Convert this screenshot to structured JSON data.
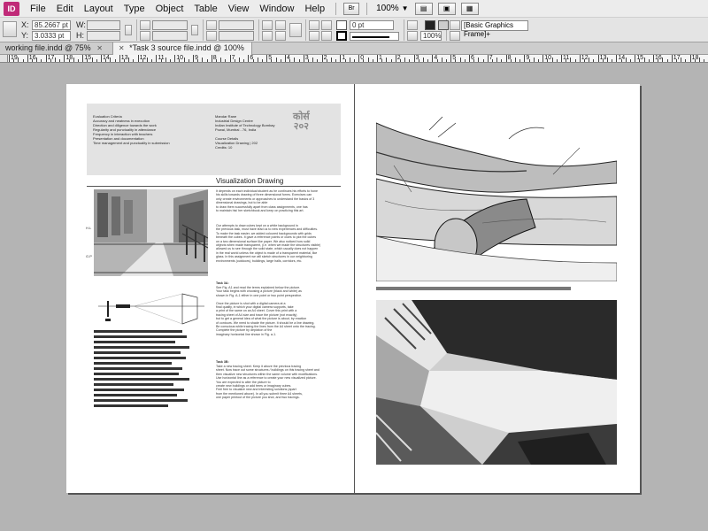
{
  "app": {
    "logo": "ID"
  },
  "menu": {
    "items": [
      "File",
      "Edit",
      "Layout",
      "Type",
      "Object",
      "Table",
      "View",
      "Window",
      "Help"
    ]
  },
  "toolbar": {
    "bridge": "Br",
    "zoom": "100%"
  },
  "control": {
    "x_label": "X:",
    "y_label": "Y:",
    "w_label": "W:",
    "h_label": "H:",
    "x_value": "85.2667 pt",
    "y_value": "3.0333 pt",
    "stroke_weight": "0 pt",
    "opacity": "100%",
    "object_style": "[Basic Graphics Frame]+"
  },
  "tabs": [
    {
      "label": "working file.indd @ 75%",
      "active": false
    },
    {
      "label": "*Task 3 source file.indd @ 100%",
      "active": true
    }
  ],
  "ruler": {
    "numbers": [
      "19",
      "16",
      "17",
      "18",
      "15",
      "14",
      "13",
      "12",
      "11",
      "10",
      "9",
      "8",
      "7",
      "6",
      "5",
      "4",
      "3",
      "2",
      "1",
      "0",
      "1",
      "2",
      "3",
      "4",
      "5",
      "6",
      "7",
      "8",
      "9",
      "10",
      "11",
      "12",
      "13",
      "14",
      "15",
      "16",
      "17",
      "18",
      "19"
    ]
  },
  "left_page": {
    "col1": "Evaluation Criteria\nAccuracy and neatness in execution\nDirection and diligence towards the work\nRegularity and punctuality in attendance\nFrequency in interaction with teachers\nPresentation and documentation\nTime management and punctuality in submission",
    "col2": "Mandar Rane\nIndustrial Design Centre\nIndian Institute of Technology Bombay\nPowai, Mumbai - 76, India\n\nCourse Details\nVisualization Drawing | 202\nCredits: 10",
    "hindi_mark": "कोर्स\n२०२",
    "title": "Visualization Drawing",
    "hl_label": "H.L",
    "gp_label": "G.P",
    "body_1": "It depends on each individual student as he continues his efforts to hone\nhis skills towards drawing of three dimensional forms. Exercises can\nonly create environments or approaches to understand the basics of 3\ndimensional drawings, but to be able\nto draw them successfully apart from class assignments, one has\nto maintain his/ her sketchbook and keep on practicing this art.",
    "body_2": "Our attempts to draw cubes kept on a white background in\nthe previous task, must have lead us to new experiences and difficulties.\nTo make the task easier, we added coloured backgrounds with grids\nbeneath the cubes. It gave a reference points or clues to plot the cubes\non a two dimensional surface like paper. We also noticed how solid\nobjects when made transparent, (i.e. when we made the structures visible)\nallowed us to see through the solid state, which usually does not happen\nin the real world unless the object is made of a transparent material, like\nglass. In this assignment we will sketch structures in our neighboring\nenvironments (outdoors), buildings, large halls, corridors, etc.",
    "task_3a_head": "Task 3A:",
    "task_3a": "See Fig. A1 and read the terms explained below the picture.\nYour task begins with choosing a picture (black and white) as\nshown in Fig. A-1 either in one point or two point perspective.\n\nOnce the picture is shot with a digital camera at a\nfinal quality, in which your digital camera supports, take\na print of the same on an A4 sheet. Cover this print with a\ntracing sheet of A4 size and trace the picture (not exactly)\nbut to get a general idea of what the picture is about, by reaction\nof contours. We need to shade the picture. It should be a line drawing.\nBe conscious while tracing the lines from the A4 sheet onto the tracing.\nComplete the picture by depiction of the\nimaginary horizontal line shown in Fig. a-1.",
    "task_3b_head": "Task 3B:",
    "task_3b": "Take a new tracing sheet. Keep it above the previous tracing\nsheet. Now trace out some structures / buildings on this tracing sheet and\nthen visualize new structures within the same volume with modifications.\nUse horizontal line as a reference to create your new visualized picture.\nYou are expected to alter the picture to\ncreate new buildings or add trees or imaginary cubes.\nFeel free to visualize new and interesting solutions (apart\nfrom the mentioned above). In all you submit three A4 sheets,\none paper printout of the picture you shot, and two tracings."
  }
}
